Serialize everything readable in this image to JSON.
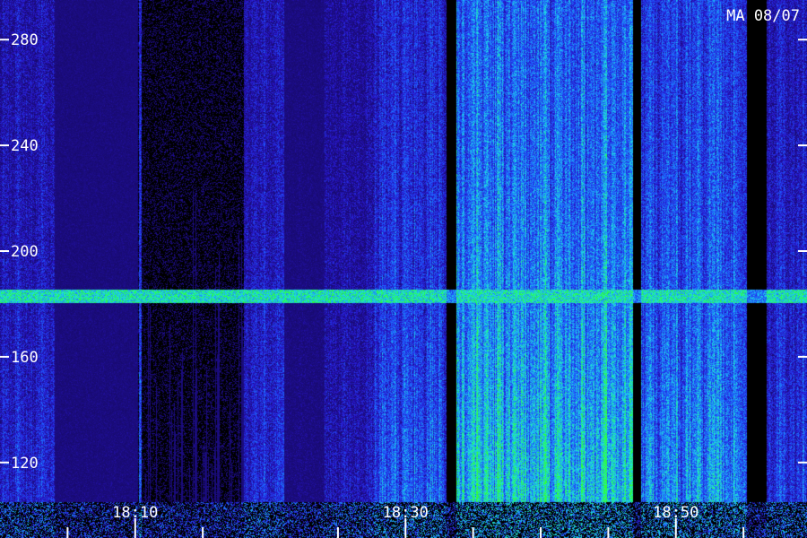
{
  "stamp": "MA 08/07",
  "chart_data": {
    "type": "heatmap",
    "title": "",
    "xlabel": "",
    "ylabel": "",
    "ylim": [
      105,
      295
    ],
    "y_ticks": [
      {
        "value": 120,
        "label": "120"
      },
      {
        "value": 160,
        "label": "160"
      },
      {
        "value": 200,
        "label": "200"
      },
      {
        "value": 240,
        "label": "240"
      },
      {
        "value": 280,
        "label": "280"
      }
    ],
    "x_minutes_range": [
      18.0,
      18.995
    ],
    "x_ticks": [
      {
        "minute": 18.1667,
        "label": "18:10"
      },
      {
        "minute": 18.5,
        "label": "18:30"
      },
      {
        "minute": 18.8333,
        "label": "18:50"
      }
    ],
    "x_minor_ticks_minutes": [
      18.0833,
      18.25,
      18.4167,
      18.5833,
      18.6667,
      18.75,
      18.9167
    ],
    "continuous_band": {
      "y_center": 183,
      "half_width": 2.5,
      "level": 0.55
    },
    "activity_segments": [
      {
        "x0": 18.0,
        "x1": 18.067,
        "level": 0.35
      },
      {
        "x0": 18.067,
        "x1": 18.17,
        "level": 0.05
      },
      {
        "x0": 18.17,
        "x1": 18.3,
        "level": 0.02
      },
      {
        "x0": 18.3,
        "x1": 18.35,
        "level": 0.38
      },
      {
        "x0": 18.35,
        "x1": 18.4,
        "level": 0.08
      },
      {
        "x0": 18.4,
        "x1": 18.46,
        "level": 0.28
      },
      {
        "x0": 18.46,
        "x1": 18.55,
        "level": 0.5
      },
      {
        "x0": 18.55,
        "x1": 18.562,
        "level": 0.0
      },
      {
        "x0": 18.562,
        "x1": 18.78,
        "level": 0.72
      },
      {
        "x0": 18.78,
        "x1": 18.79,
        "level": 0.0
      },
      {
        "x0": 18.79,
        "x1": 18.92,
        "level": 0.6
      },
      {
        "x0": 18.92,
        "x1": 18.945,
        "level": 0.0
      },
      {
        "x0": 18.945,
        "x1": 18.995,
        "level": 0.4
      }
    ],
    "bursts": [
      {
        "x": 18.173,
        "level": 0.6
      }
    ],
    "colors": {
      "background": "#000000",
      "low": "#2a14c8",
      "mid": "#1e6cff",
      "high": "#1ee6e6",
      "peak": "#28ff28"
    }
  }
}
